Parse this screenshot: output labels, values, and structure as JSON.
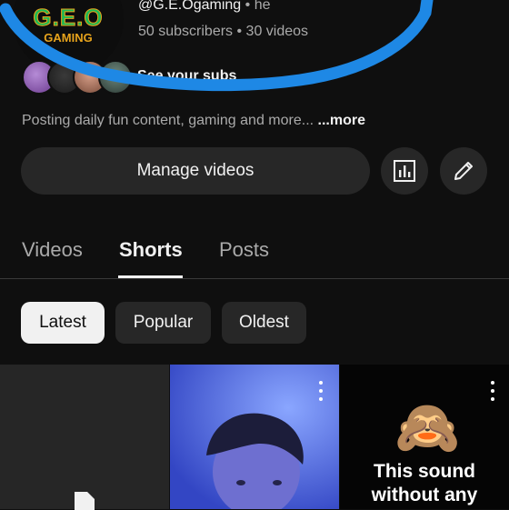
{
  "channel": {
    "logo_text": "G.E.O",
    "logo_subtext": "GAMING",
    "handle": "@G.E.Ogaming",
    "handle_suffix": "he",
    "separator": "•",
    "stats": "50 subscribers • 30 videos",
    "subscribers_link": "See your subs",
    "description": "Posting daily fun content, gaming and more...",
    "more_label": "...more"
  },
  "actions": {
    "manage_videos_label": "Manage videos",
    "analytics_icon": "bar-chart-icon",
    "edit_icon": "pencil-icon"
  },
  "tabs": [
    {
      "label": "Videos",
      "active": false
    },
    {
      "label": "Shorts",
      "active": true
    },
    {
      "label": "Posts",
      "active": false
    }
  ],
  "filters": [
    {
      "label": "Latest",
      "selected": true
    },
    {
      "label": "Popular",
      "selected": false
    },
    {
      "label": "Oldest",
      "selected": false
    }
  ],
  "shorts": [
    {
      "thumbnail": "blank",
      "icon": "document-icon"
    },
    {
      "thumbnail": "person-blue",
      "menu_icon": "kebab-icon"
    },
    {
      "thumbnail": "emoji-text",
      "emoji": "🙈",
      "caption_line1": "This sound",
      "caption_line2": "without any",
      "menu_icon": "kebab-icon"
    }
  ],
  "colors": {
    "background": "#0f0f0f",
    "surface": "#272727",
    "text_primary": "#f1f1f1",
    "text_secondary": "#aaaaaa",
    "scribble": "#1e88e5"
  }
}
